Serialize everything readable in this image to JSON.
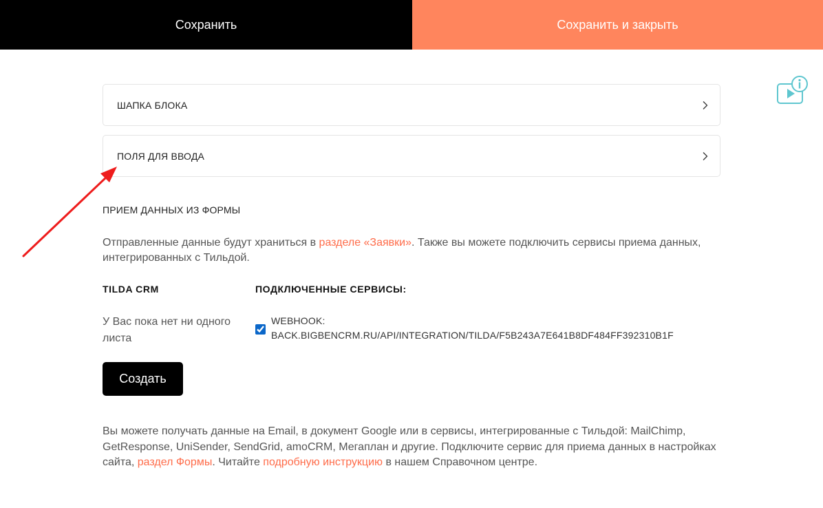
{
  "topbar": {
    "save_label": "Сохранить",
    "save_close_label": "Сохранить и закрыть"
  },
  "help": {
    "icon": "video-info-icon",
    "color": "#5ec6cf"
  },
  "accordion": [
    {
      "label": "ШАПКА БЛОКА",
      "icon": "chevron-right-icon"
    },
    {
      "label": "ПОЛЯ ДЛЯ ВВОДА",
      "icon": "chevron-right-icon"
    }
  ],
  "annotation": {
    "type": "red-arrow",
    "color": "#ee1c1c"
  },
  "form_data": {
    "title": "ПРИЕМ ДАННЫХ ИЗ ФОРМЫ",
    "desc_before": "Отправленные данные будут храниться в ",
    "desc_link": "разделе «Заявки»",
    "desc_after": ". Также вы можете подключить сервисы приема данных, интегрированных с Тильдой."
  },
  "crm": {
    "title": "TILDA CRM",
    "empty_text": "У Вас пока нет ни одного листа",
    "create_label": "Создать"
  },
  "services": {
    "title": "ПОДКЛЮЧЕННЫЕ СЕРВИСЫ:",
    "items": [
      {
        "checked": true,
        "line1": "WEBHOOK:",
        "line2": "BACK.BIGBENCRM.RU/API/INTEGRATION/TILDA/F5B243A7E641B8DF484FF392310B1F"
      }
    ]
  },
  "footer": {
    "text_before": "Вы можете получать данные на Email, в документ Google или в сервисы, интегрированные с Тильдой: MailChimp, GetResponse, UniSender, SendGrid, amoCRM, Мегаплан и другие. Подключите сервис для приема данных в настройках сайта, ",
    "link1": "раздел Формы",
    "text_middle": ". Читайте ",
    "link2": "подробную инструкцию",
    "text_after": " в нашем Справочном центре."
  },
  "colors": {
    "accent": "#ff855d",
    "link": "#ff6c4a",
    "dark": "#000000"
  }
}
